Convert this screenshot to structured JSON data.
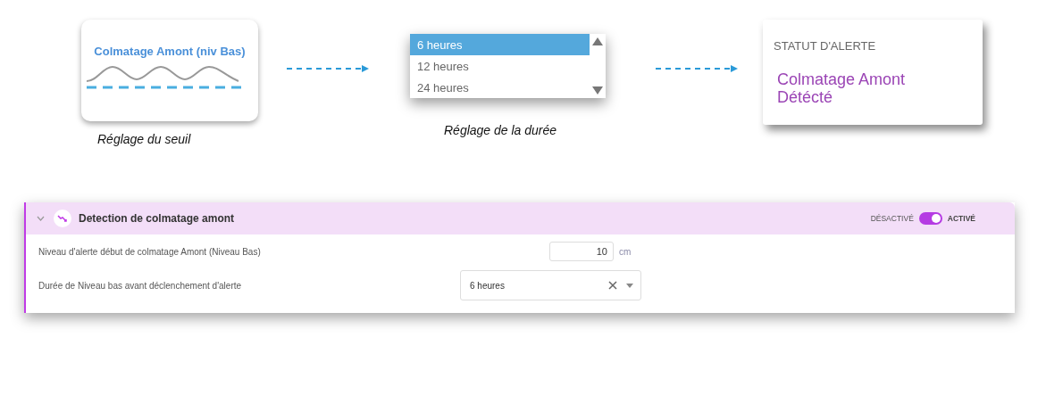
{
  "diagram": {
    "threshold_card": {
      "title": "Colmatage Amont (niv Bas)",
      "caption": "Réglage du seuil"
    },
    "duration_list": {
      "options": [
        {
          "label": "6 heures",
          "selected": true
        },
        {
          "label": "12 heures",
          "selected": false
        },
        {
          "label": "24 heures",
          "selected": false
        }
      ],
      "caption": "Réglage de la durée"
    },
    "alert_card": {
      "label": "STATUT D'ALERTE",
      "status": "Colmatage Amont Détécté"
    }
  },
  "panel": {
    "title": "Detection de colmatage amont",
    "expanded": true,
    "toggle": {
      "off_label": "DÉSACTIVÉ",
      "on_label": "ACTIVÉ",
      "on": true
    },
    "fields": [
      {
        "kind": "number",
        "label": "Niveau d'alerte début de colmatage Amont (Niveau Bas)",
        "value": "10",
        "unit": "cm"
      },
      {
        "kind": "select",
        "label": "Durée de Niveau bas avant déclenchement d'alerte",
        "value": "6 heures"
      }
    ]
  }
}
